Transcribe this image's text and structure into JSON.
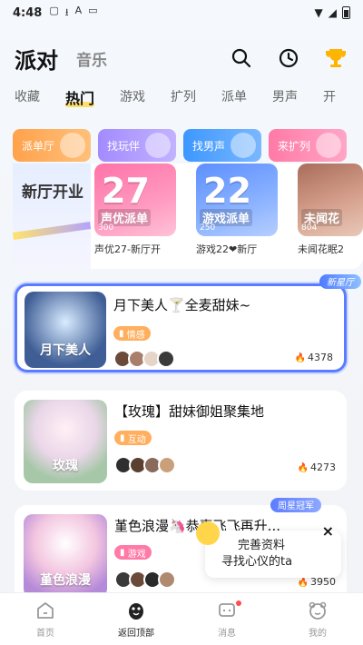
{
  "status": {
    "time": "4:48"
  },
  "header": {
    "title": "派对",
    "music": "音乐"
  },
  "tabs": [
    {
      "label": "收藏"
    },
    {
      "label": "热门"
    },
    {
      "label": "游戏"
    },
    {
      "label": "扩列"
    },
    {
      "label": "派单"
    },
    {
      "label": "男声"
    },
    {
      "label": "开"
    }
  ],
  "categories": [
    {
      "label": "派单厅"
    },
    {
      "label": "找玩伴"
    },
    {
      "label": "找男声"
    },
    {
      "label": "来扩列"
    }
  ],
  "promo": {
    "left_title": "新厅开业"
  },
  "banners": [
    {
      "num": "27",
      "sub": "声优派单",
      "hot": "300",
      "caption": "声优27-新厅开"
    },
    {
      "num": "22",
      "sub": "游戏派单",
      "hot": "250",
      "caption": "游戏22❤新厅"
    },
    {
      "num": "",
      "sub": "未闻花",
      "hot": "804",
      "caption": "未闻花眠2"
    }
  ],
  "rooms": [
    {
      "badge": "新星厅",
      "name": "月下美人🍸全麦甜妹~",
      "thumb_text": "月下美人",
      "tag": "情感",
      "count": "4378"
    },
    {
      "badge": "",
      "name": "【玫瑰】甜妹御姐聚集地",
      "thumb_text": "玫瑰",
      "tag": "互动",
      "count": "4273"
    },
    {
      "badge": "周星冠军",
      "name": "堇色浪漫🦄恭喜飞飞再升...",
      "thumb_text": "堇色浪漫",
      "tag": "游戏",
      "count": "3950"
    }
  ],
  "prompt": {
    "line1": "完善资料",
    "line2": "寻找心仪的ta",
    "close": "×"
  },
  "nav": [
    {
      "label": "首页"
    },
    {
      "label": "返回顶部"
    },
    {
      "label": "消息"
    },
    {
      "label": "我的"
    }
  ]
}
